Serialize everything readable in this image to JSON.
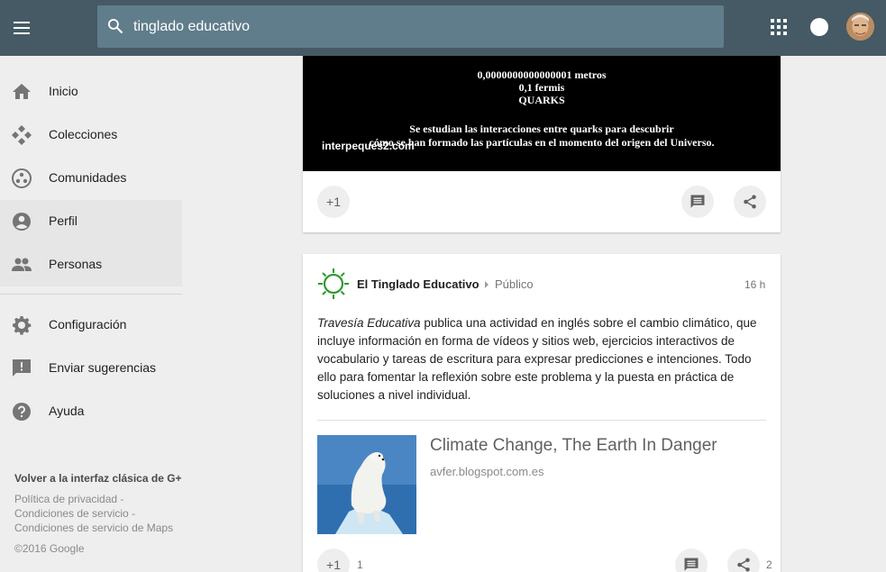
{
  "header": {
    "search_value": "tinglado educativo"
  },
  "sidebar": {
    "items": [
      {
        "label": "Inicio",
        "icon": "home-icon"
      },
      {
        "label": "Colecciones",
        "icon": "collections-icon"
      },
      {
        "label": "Comunidades",
        "icon": "communities-icon"
      },
      {
        "label": "Perfil",
        "icon": "profile-icon"
      },
      {
        "label": "Personas",
        "icon": "people-icon"
      },
      {
        "label": "Configuración",
        "icon": "gear-icon"
      },
      {
        "label": "Enviar sugerencias",
        "icon": "feedback-icon"
      },
      {
        "label": "Ayuda",
        "icon": "help-icon"
      }
    ],
    "classic_link": "Volver a la interfaz clásica de G+",
    "footer_links": [
      "Política de privacidad -",
      "Condiciones de servicio -",
      "Condiciones de servicio de Maps"
    ],
    "copyright": "©2016 Google"
  },
  "post1": {
    "image_lines": [
      "0,0000000000000001 metros",
      "0,1 fermis",
      "QUARKS"
    ],
    "image_caption_1": "Se estudian las interacciones entre quarks para descubrir",
    "image_caption_2": "cómo se han formado las partículas en el momento del origen del Universo.",
    "watermark": "interpeques2.com",
    "plus_one_label": "+1"
  },
  "post2": {
    "author": "El Tinglado Educativo",
    "visibility": "Público",
    "time": "16 h",
    "body_italic": "Travesía Educativa",
    "body_text": " publica una actividad en inglés sobre el cambio climático, que incluye información en forma de vídeos y sitios web, ejercicios interactivos de vocabulario y tareas de escritura para expresar predicciones e intenciones. Todo ello para fomentar la reflexión sobre este problema y la puesta en práctica de soluciones a nivel individual.",
    "link_title": "Climate Change, The Earth In Danger",
    "link_domain": "avfer.blogspot.com.es",
    "plus_one_label": "+1",
    "plus_one_count": "1",
    "share_count": "2"
  },
  "colors": {
    "topbar": "#455a64",
    "search_bg": "#607d8b",
    "author_icon_green": "#2e9a2e"
  }
}
